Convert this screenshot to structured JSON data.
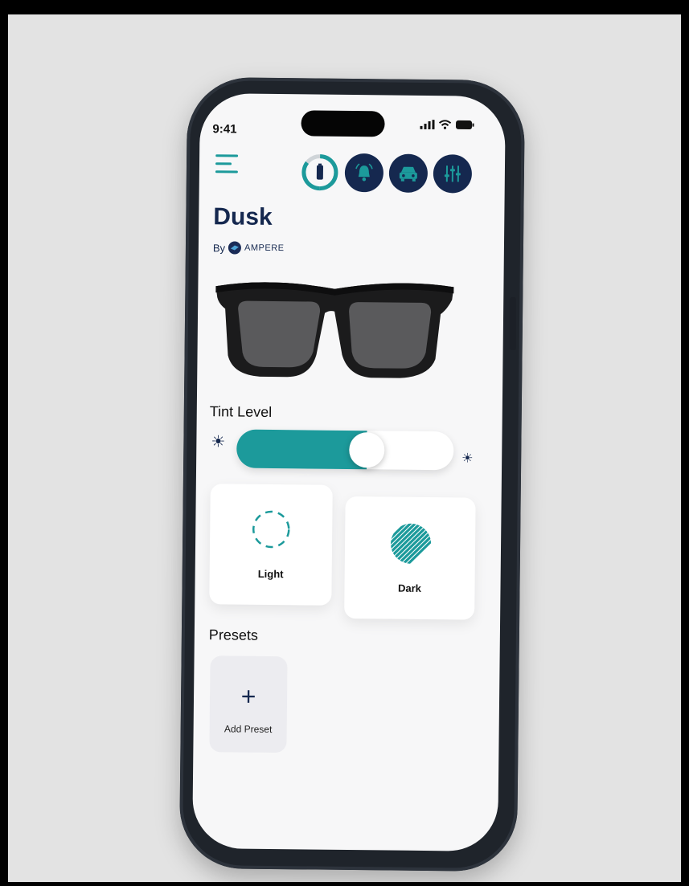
{
  "status_bar": {
    "time": "9:41"
  },
  "header": {
    "menu_icon": "menu-icon",
    "icons": [
      "battery-icon",
      "alarm-bell-icon",
      "car-icon",
      "sliders-icon"
    ]
  },
  "product": {
    "name": "Dusk",
    "by_label": "By",
    "brand": "AMPERE"
  },
  "tint": {
    "label": "Tint Level",
    "level_fraction": 0.6
  },
  "modes": [
    {
      "label": "Light"
    },
    {
      "label": "Dark"
    }
  ],
  "presets": {
    "label": "Presets",
    "add_label": "Add Preset"
  },
  "colors": {
    "accent": "#1c9a9b",
    "navy": "#15284f",
    "background": "#e3e3e3"
  }
}
